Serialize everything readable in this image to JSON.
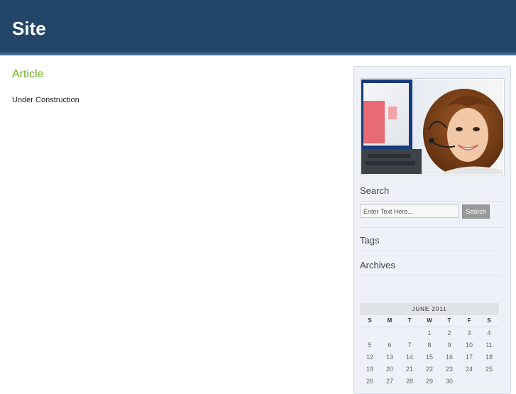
{
  "header": {
    "site_title": "Site"
  },
  "article": {
    "title": "Article",
    "body": "Under Construction"
  },
  "sidebar": {
    "search": {
      "title": "Search",
      "input_value": "Enter Text Here...",
      "button_label": "Search"
    },
    "tags": {
      "title": "Tags"
    },
    "archives": {
      "title": "Archives"
    },
    "calendar": {
      "caption": "JUNE 2011",
      "weekdays": [
        "S",
        "M",
        "T",
        "W",
        "T",
        "F",
        "S"
      ],
      "weeks": [
        [
          "",
          "",
          "",
          "1",
          "2",
          "3",
          "4"
        ],
        [
          "5",
          "6",
          "7",
          "8",
          "9",
          "10",
          "11"
        ],
        [
          "12",
          "13",
          "14",
          "15",
          "16",
          "17",
          "18"
        ],
        [
          "19",
          "20",
          "21",
          "22",
          "23",
          "24",
          "25"
        ],
        [
          "26",
          "27",
          "28",
          "29",
          "30",
          "",
          ""
        ]
      ]
    }
  },
  "colors": {
    "header_bg": "#234668",
    "header_stripe": "#3f6a90",
    "article_title": "#6ab01c",
    "sidebar_bg": "#eef2f8"
  }
}
